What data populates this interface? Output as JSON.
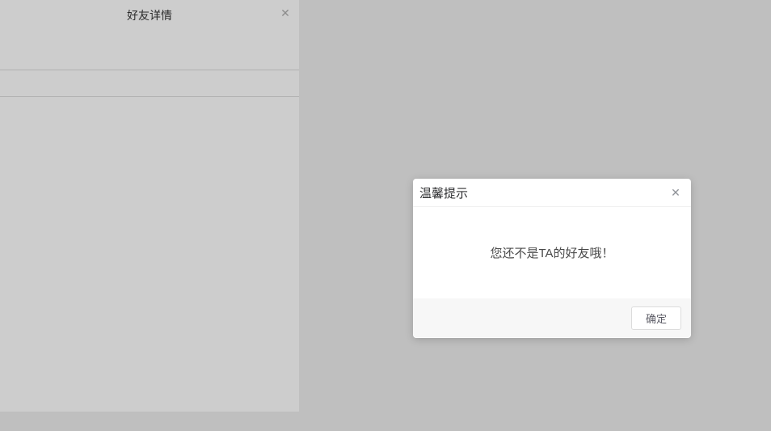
{
  "colors": {
    "background": "#bfbfbf",
    "panel_background": "#cdcdcd",
    "panel_divider": "#b1b1b1",
    "dialog_background": "#ffffff",
    "dialog_footer_background": "#f7f7f7",
    "dialog_divider": "#f0f0f0",
    "dialog_title_text": "#303133",
    "dialog_body_text": "#4a4a4a",
    "close_icon_color": "#909399",
    "button_border": "#dcdcdc",
    "button_text": "#5c5c66"
  },
  "panel": {
    "title": "好友详情",
    "close_icon": "✕"
  },
  "dialog": {
    "title": "温馨提示",
    "close_icon": "✕",
    "message": "您还不是TA的好友哦！",
    "confirm_button": "确定"
  }
}
